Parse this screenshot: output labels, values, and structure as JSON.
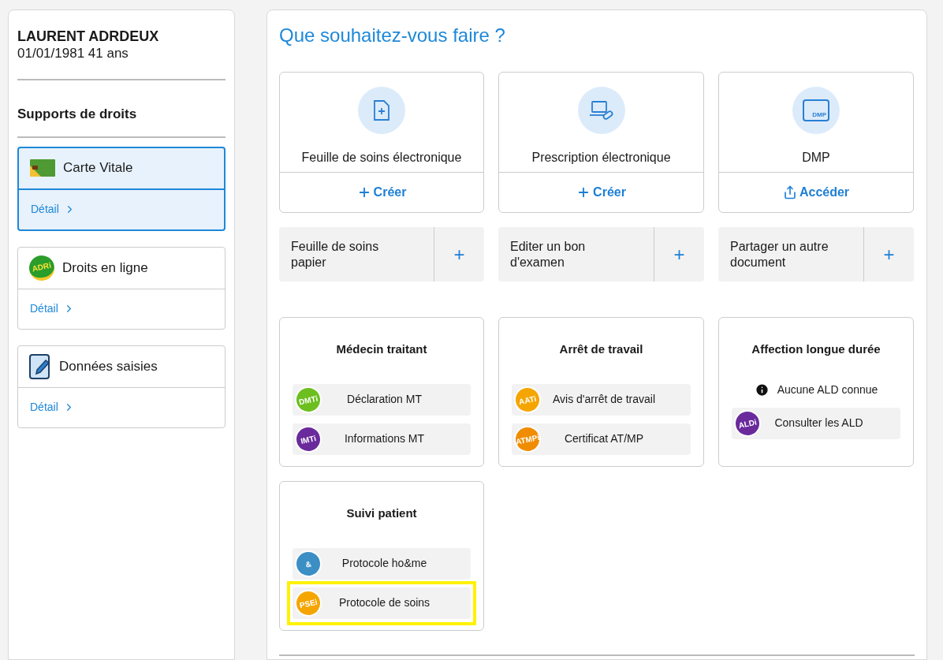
{
  "patient": {
    "name": "LAURENT ADRDEUX",
    "birth": "01/01/1981 41 ans"
  },
  "supports": {
    "title": "Supports de droits",
    "items": [
      {
        "kind": "card",
        "label": "Carte Vitale",
        "link": "Détail",
        "selected": true
      },
      {
        "kind": "adri",
        "badge": "ADRi",
        "label": "Droits en ligne",
        "link": "Détail",
        "selected": false
      },
      {
        "kind": "pencil",
        "label": "Données saisies",
        "link": "Détail",
        "selected": false
      }
    ]
  },
  "heading": "Que souhaitez-vous faire ?",
  "main_actions": [
    {
      "kind": "document",
      "title": "Feuille de soins électronique",
      "action": {
        "kind": "plus",
        "label": "Créer"
      }
    },
    {
      "kind": "laptop",
      "title": "Prescription électronique",
      "action": {
        "kind": "plus",
        "label": "Créer"
      }
    },
    {
      "kind": "folder",
      "folder_label": "DMP",
      "title": "DMP",
      "action": {
        "kind": "share",
        "label": "Accéder"
      }
    }
  ],
  "secondary_actions": [
    {
      "label": "Feuille de soins papier",
      "button": "+"
    },
    {
      "label": "Editer un bon d'examen",
      "button": "+"
    },
    {
      "label": "Partager un autre document",
      "button": "+"
    }
  ],
  "sections": [
    {
      "title": "Médecin traitant",
      "items": [
        {
          "badge": "DMTi",
          "color": "#6cbf1e",
          "label": "Déclaration MT",
          "highlighted": false
        },
        {
          "badge": "IMTi",
          "color": "#6a2a9c",
          "label": "Informations MT",
          "highlighted": false
        }
      ]
    },
    {
      "title": "Arrêt de travail",
      "items": [
        {
          "badge": "AATi",
          "color": "#f5a500",
          "label": "Avis d'arrêt de travail",
          "highlighted": false
        },
        {
          "badge": "ATMPi",
          "color": "#f08c00",
          "label": "Certificat AT/MP",
          "highlighted": false
        }
      ]
    },
    {
      "title": "Affection longue durée",
      "notice": "Aucune ALD connue",
      "items": [
        {
          "badge": "ALDi",
          "color": "#6a2a9c",
          "label": "Consulter les ALD",
          "highlighted": false
        }
      ]
    },
    {
      "title": "Suivi patient",
      "items": [
        {
          "badge": "&",
          "color": "#3b8fc4",
          "label": "Protocole ho&me",
          "highlighted": false
        },
        {
          "badge": "PSEi",
          "color": "#f5a500",
          "label": "Protocole de soins",
          "highlighted": true
        }
      ]
    }
  ]
}
